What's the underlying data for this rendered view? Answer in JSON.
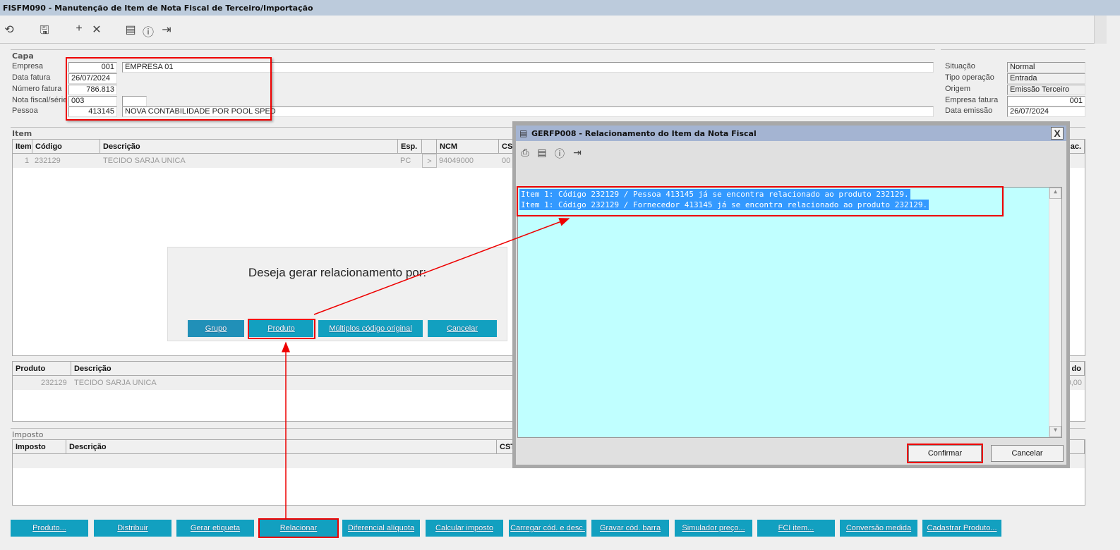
{
  "window": {
    "title": "FISFM090 - Manutenção de Item de Nota Fiscal de Terceiro/Importação"
  },
  "toolbar": {
    "icons": [
      "undo-icon",
      "save-icon",
      "add-icon",
      "delete-icon",
      "calendar-icon",
      "help-icon",
      "exit-icon"
    ]
  },
  "capa": {
    "title": "Capa",
    "empresa_label": "Empresa",
    "empresa_code": "001",
    "empresa_name": "EMPRESA 01",
    "data_fatura_label": "Data fatura",
    "data_fatura": "26/07/2024",
    "numero_fatura_label": "Número fatura",
    "numero_fatura": "786.813",
    "nota_label": "Nota fiscal/série",
    "nota": "003",
    "serie": "",
    "pessoa_label": "Pessoa",
    "pessoa_code": "413145",
    "pessoa_name": "NOVA CONTABILIDADE POR POOL SPED",
    "situacao_label": "Situação",
    "situacao": "Normal",
    "tipo_label": "Tipo operação",
    "tipo": "Entrada",
    "origem_label": "Origem",
    "origem": "Emissão Terceiro",
    "empresa_fatura_label": "Empresa fatura",
    "empresa_fatura": "001",
    "data_emissao_label": "Data emissão",
    "data_emissao": "26/07/2024"
  },
  "item": {
    "title": "Item",
    "headers": [
      "Item",
      "Código",
      "Descrição",
      "Esp.",
      "",
      "NCM",
      "CS",
      "p. ac."
    ],
    "row": {
      "item": "1",
      "codigo": "232129",
      "descricao": "TECIDO SARJA UNICA",
      "esp": "PC",
      "expand": ">",
      "ncm": "94049000",
      "cst": "00"
    }
  },
  "produto": {
    "headers": [
      "Produto",
      "Descrição",
      "do"
    ],
    "row": {
      "produto": "232129",
      "descricao": "TECIDO SARJA UNICA",
      "valor": "0,00"
    }
  },
  "imposto": {
    "title": "Imposto",
    "headers": [
      "Imposto",
      "Descrição",
      "CST"
    ]
  },
  "popup": {
    "question": "Deseja gerar relacionamento por:",
    "buttons": [
      "Grupo",
      "Produto",
      "Múltiplos código original",
      "Cancelar"
    ]
  },
  "modal": {
    "title": "GERFP008 - Relacionamento do Item da Nota Fiscal",
    "close": "X",
    "lines": [
      "Item 1: Código 232129 / Pessoa 413145 já se encontra relacionado ao produto 232129.",
      "Item 1: Código 232129 / Fornecedor 413145 já se encontra relacionado ao produto 232129."
    ],
    "confirm": "Confirmar",
    "cancel": "Cancelar"
  },
  "bottom_buttons": [
    "Produto...",
    "Distribuir",
    "Gerar etiqueta",
    "Relacionar",
    "Diferencial alíquota",
    "Calcular imposto",
    "Carregar cód. e desc.",
    "Gravar cód. barra",
    "Simulador preço...",
    "FCI item...",
    "Conversão medida",
    "Cadastrar Produto..."
  ],
  "colors": {
    "accent": "#12a0c0",
    "highlight": "#ee0000",
    "textarea": "#c0ffff",
    "selection": "#3399ff"
  }
}
